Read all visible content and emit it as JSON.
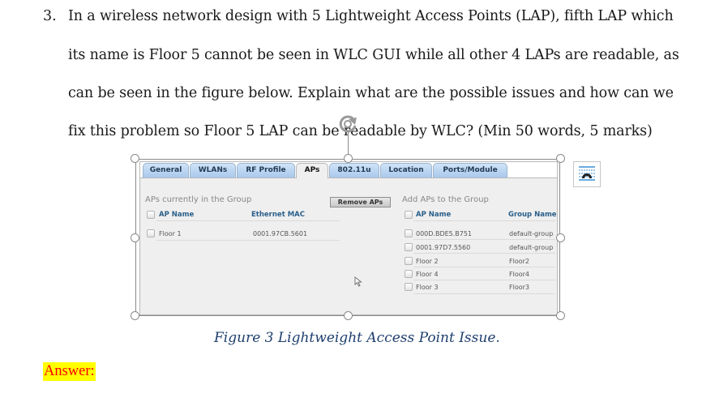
{
  "question": {
    "number": "3.",
    "lines": [
      "In a wireless network design with 5 Lightweight Access Points (LAP), fifth LAP which",
      "its name is Floor 5 cannot be seen in WLC GUI while all other 4 LAPs are readable, as",
      "can be seen in the figure below. Explain what are the possible issues and how can we",
      "fix this problem so Floor 5 LAP can be readable by WLC? (Min 50 words, 5 marks)"
    ]
  },
  "figure": {
    "tabs": [
      "General",
      "WLANs",
      "RF Profile",
      "APs",
      "802.11u",
      "Location",
      "Ports/Module"
    ],
    "active_tab": "APs",
    "current_group": {
      "title": "APs currently in the Group",
      "columns": [
        "AP Name",
        "Ethernet MAC"
      ],
      "rows": [
        {
          "ap_name": "Floor 1",
          "mac": "0001.97CB.5601"
        }
      ]
    },
    "remove_button": "Remove APs",
    "add_group": {
      "title": "Add APs to the Group",
      "columns": [
        "AP Name",
        "Group Name"
      ],
      "rows": [
        {
          "ap_name": "000D.BDE5.B751",
          "group": "default-group"
        },
        {
          "ap_name": "0001.97D7.5560",
          "group": "default-group"
        },
        {
          "ap_name": "Floor 2",
          "group": "Floor2"
        },
        {
          "ap_name": "Floor 4",
          "group": "Floor4"
        },
        {
          "ap_name": "Floor 3",
          "group": "Floor3"
        }
      ]
    }
  },
  "caption": "Figure 3 Lightweight Access Point Issue.",
  "answer_label": "Answer:",
  "icons": {
    "rotate": "rotate-handle-icon",
    "layout": "layout-options-icon",
    "cursor": "mouse-cursor-icon"
  }
}
